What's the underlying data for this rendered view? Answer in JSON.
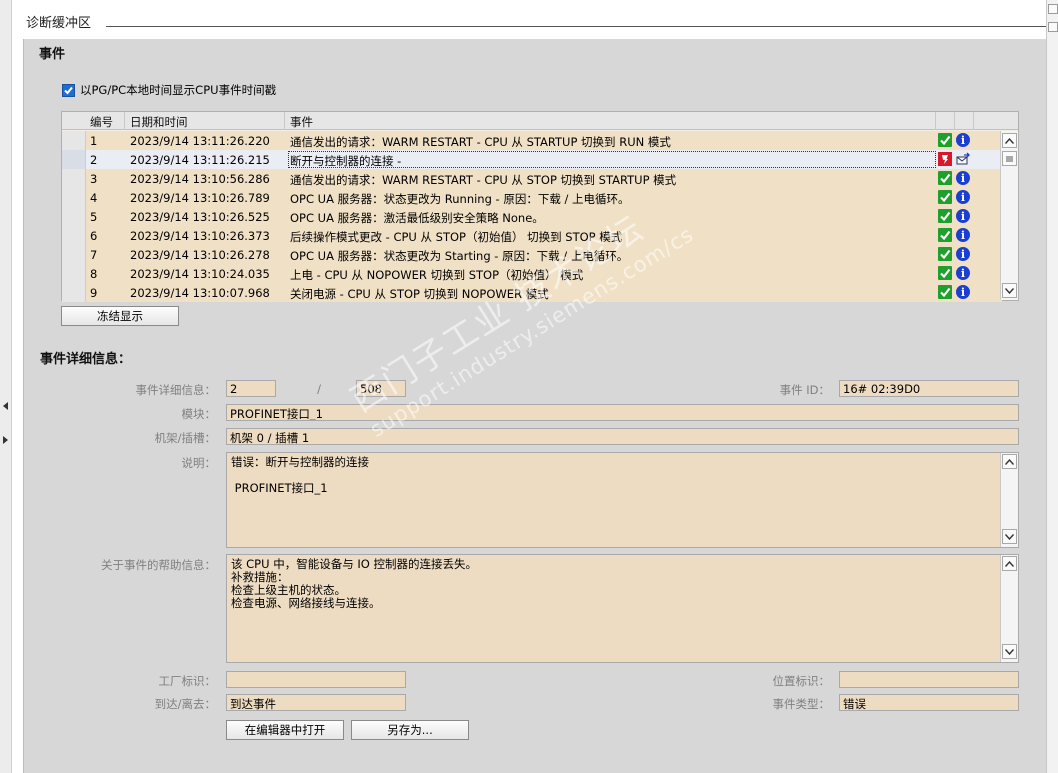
{
  "panel": {
    "title": "诊断缓冲区"
  },
  "events_section": {
    "title": "事件",
    "checkbox_label": "以PG/PC本地时间显示CPU事件时间戳",
    "checkbox_checked": true,
    "columns": [
      "编号",
      "日期和时间",
      "事件"
    ],
    "rows": [
      {
        "no": "1",
        "datetime": "2023/9/14 13:11:26.220",
        "event": "通信发出的请求：WARM RESTART - CPU 从 STARTUP 切换到 RUN 模式",
        "status_icon": "ok-check-icon",
        "type_icon": "info-icon"
      },
      {
        "no": "2",
        "datetime": "2023/9/14 13:11:26.215",
        "event": "断开与控制器的连接 -",
        "status_icon": "error-warning-icon",
        "type_icon": "outgoing-event-icon"
      },
      {
        "no": "3",
        "datetime": "2023/9/14 13:10:56.286",
        "event": "通信发出的请求：WARM RESTART - CPU 从 STOP 切换到 STARTUP 模式",
        "status_icon": "ok-check-icon",
        "type_icon": "info-icon"
      },
      {
        "no": "4",
        "datetime": "2023/9/14 13:10:26.789",
        "event": "OPC UA 服务器：状态更改为 Running - 原因：下载 / 上电循环。",
        "status_icon": "ok-check-icon",
        "type_icon": "info-icon"
      },
      {
        "no": "5",
        "datetime": "2023/9/14 13:10:26.525",
        "event": "OPC UA 服务器：激活最低级别安全策略 None。",
        "status_icon": "ok-check-icon",
        "type_icon": "info-icon"
      },
      {
        "no": "6",
        "datetime": "2023/9/14 13:10:26.373",
        "event": "后续操作模式更改 - CPU 从 STOP（初始值） 切换到 STOP 模式",
        "status_icon": "ok-check-icon",
        "type_icon": "info-icon"
      },
      {
        "no": "7",
        "datetime": "2023/9/14 13:10:26.278",
        "event": "OPC UA 服务器：状态更改为 Starting - 原因：下载 / 上电循环。",
        "status_icon": "ok-check-icon",
        "type_icon": "info-icon"
      },
      {
        "no": "8",
        "datetime": "2023/9/14 13:10:24.035",
        "event": "上电 - CPU 从 NOPOWER 切换到 STOP（初始值） 模式",
        "status_icon": "ok-check-icon",
        "type_icon": "info-icon"
      },
      {
        "no": "9",
        "datetime": "2023/9/14 13:10:07.968",
        "event": "关闭电源 - CPU 从 STOP 切换到 NOPOWER 模式",
        "status_icon": "ok-check-icon",
        "type_icon": "info-icon"
      }
    ],
    "selected_row": "2",
    "freeze_button": "冻结显示"
  },
  "details": {
    "title": "事件详细信息：",
    "detail_label": "事件详细信息：",
    "detail_index": "2",
    "detail_separator": "/",
    "detail_total": "508",
    "event_id_label": "事件 ID：",
    "event_id": "16# 02:39D0",
    "module_label": "模块：",
    "module": "PROFINET接口_1",
    "rack_label": "机架/插槽：",
    "rack": "机架 0 / 插槽 1",
    "description_label": "说明：",
    "description_lines": [
      "错误：断开与控制器的连接",
      "",
      " PROFINET接口_1"
    ],
    "help_label": "关于事件的帮助信息：",
    "help_lines": [
      "该 CPU 中，智能设备与 IO 控制器的连接丢失。",
      "补救措施：",
      "检查上级主机的状态。",
      "检查电源、网络接线与连接。"
    ],
    "plant_label": "工厂标识：",
    "plant": "",
    "location_label": "位置标识：",
    "location": "",
    "arrival_label": "到达/离去：",
    "arrival": "到达事件",
    "event_type_label": "事件类型：",
    "event_type": "错误",
    "open_editor_button": "在编辑器中打开",
    "save_as_button": "另存为..."
  },
  "watermark": {
    "line1": "西门子工业  技术论坛",
    "line2": "support.industry.siemens.com/cs"
  },
  "colors": {
    "panel_bg": "#d7d7d7",
    "field_bg": "#eedcc2",
    "row_bg": "#f0e1c6",
    "ok_green": "#1fa02c",
    "info_blue": "#1a3fd1",
    "error_red": "#d7182a"
  }
}
